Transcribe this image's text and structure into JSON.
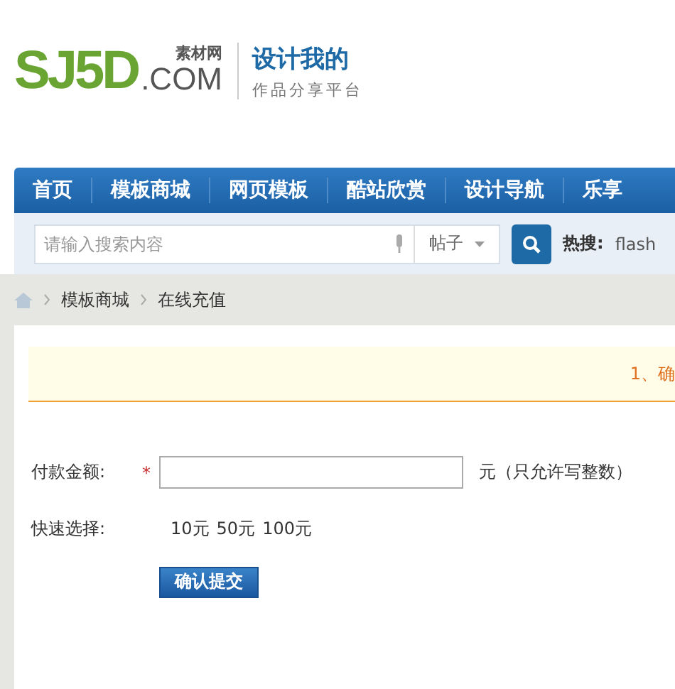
{
  "logo": {
    "mark": "SJ5D",
    "sub": "素材网",
    "domain": ".COM",
    "slogan": "设计我的",
    "tagline": "作品分享平台"
  },
  "nav": [
    {
      "label": "首页"
    },
    {
      "label": "模板商城"
    },
    {
      "label": "网页模板"
    },
    {
      "label": "酷站欣赏"
    },
    {
      "label": "设计导航"
    },
    {
      "label": "乐享"
    }
  ],
  "search": {
    "placeholder": "请输入搜索内容",
    "category": "帖子",
    "hot_label": "热搜:",
    "hot": [
      "flash"
    ]
  },
  "breadcrumb": [
    "模板商城",
    "在线充值"
  ],
  "notice": "1、确",
  "form": {
    "amount_label": "付款金额:",
    "required_mark": "*",
    "unit_hint": "元（只允许写整数）",
    "quick_label": "快速选择:",
    "quick": [
      "10元",
      "50元",
      "100元"
    ],
    "submit": "确认提交"
  }
}
